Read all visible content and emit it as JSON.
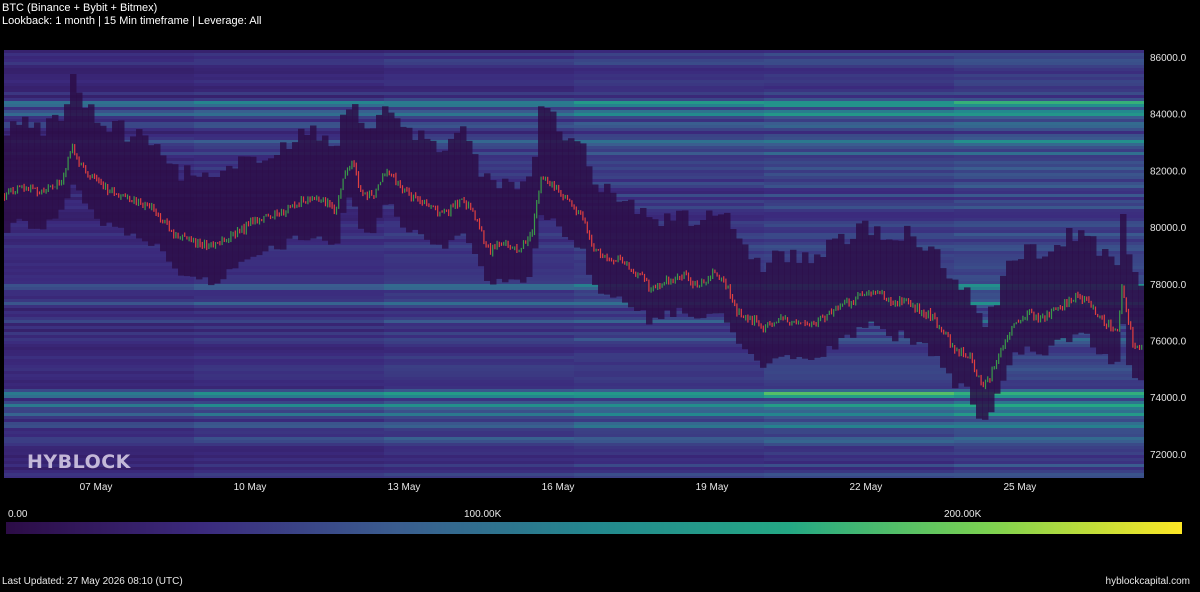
{
  "header": {
    "title": "BTC (Binance + Bybit + Bitmex)",
    "subtitle": "Lookback: 1 month | 15 Min timeframe | Leverage: All"
  },
  "watermark": "HYBLOCK",
  "footer": {
    "last_updated": "Last Updated: 27 May 2026 08:10 (UTC)",
    "site": "hyblockcapital.com"
  },
  "colors": {
    "background": "#000000",
    "colormap": [
      "#2c0c46",
      "#3b2a7d",
      "#3a5d8f",
      "#23888e",
      "#24a884",
      "#7ad151",
      "#fde725"
    ],
    "candle_up": "#3a9a4a",
    "candle_down": "#e04040"
  },
  "chart_data": {
    "type": "heatmap",
    "title": "BTC (Binance + Bybit + Bitmex)",
    "x_ticks": [
      "07 May",
      "10 May",
      "13 May",
      "16 May",
      "19 May",
      "22 May",
      "25 May"
    ],
    "x_range": [
      "05 May",
      "27 May 08:10"
    ],
    "y_ticks": [
      "72000.0",
      "74000.0",
      "76000.0",
      "78000.0",
      "80000.0",
      "82000.0",
      "84000.0",
      "86000.0"
    ],
    "ylim": [
      71000,
      86300
    ],
    "colorbar": {
      "labels": [
        "0.00",
        "100.00K",
        "200.00K"
      ],
      "ticks": [
        0,
        100000,
        200000
      ],
      "max": 245000
    },
    "liquidation_bands": [
      {
        "price": 84350,
        "intensity": 190000
      },
      {
        "price": 84000,
        "intensity": 160000
      },
      {
        "price": 83600,
        "intensity": 120000
      },
      {
        "price": 83000,
        "intensity": 140000
      },
      {
        "price": 82600,
        "intensity": 100000
      },
      {
        "price": 77900,
        "intensity": 150000
      },
      {
        "price": 77300,
        "intensity": 130000
      },
      {
        "price": 76700,
        "intensity": 110000
      },
      {
        "price": 76000,
        "intensity": 100000
      },
      {
        "price": 74100,
        "intensity": 210000
      },
      {
        "price": 73700,
        "intensity": 170000
      },
      {
        "price": 73400,
        "intensity": 150000
      },
      {
        "price": 73000,
        "intensity": 140000
      },
      {
        "price": 72500,
        "intensity": 120000
      }
    ],
    "price_series": {
      "name": "BTC",
      "points": [
        [
          "05 May 00:00",
          80900
        ],
        [
          "05 May 12:00",
          81400
        ],
        [
          "06 May 00:00",
          81200
        ],
        [
          "06 May 08:00",
          81700
        ],
        [
          "06 May 13:00",
          82800
        ],
        [
          "06 May 20:00",
          81800
        ],
        [
          "07 May 06:00",
          81300
        ],
        [
          "07 May 16:00",
          81000
        ],
        [
          "08 May 02:00",
          80700
        ],
        [
          "08 May 12:00",
          79800
        ],
        [
          "08 May 22:00",
          79500
        ],
        [
          "09 May 08:00",
          79300
        ],
        [
          "09 May 18:00",
          79800
        ],
        [
          "10 May 04:00",
          80300
        ],
        [
          "10 May 14:00",
          80500
        ],
        [
          "11 May 00:00",
          80900
        ],
        [
          "11 May 10:00",
          81000
        ],
        [
          "11 May 16:00",
          80600
        ],
        [
          "11 May 20:00",
          81900
        ],
        [
          "12 May 00:00",
          82400
        ],
        [
          "12 May 04:00",
          81100
        ],
        [
          "12 May 10:00",
          81200
        ],
        [
          "12 May 16:00",
          82100
        ],
        [
          "12 May 22:00",
          81400
        ],
        [
          "13 May 08:00",
          80900
        ],
        [
          "13 May 18:00",
          80400
        ],
        [
          "14 May 04:00",
          81000
        ],
        [
          "14 May 10:00",
          80200
        ],
        [
          "14 May 16:00",
          79100
        ],
        [
          "14 May 22:00",
          79500
        ],
        [
          "15 May 06:00",
          79200
        ],
        [
          "15 May 12:00",
          79800
        ],
        [
          "15 May 16:00",
          81700
        ],
        [
          "15 May 22:00",
          81500
        ],
        [
          "16 May 04:00",
          80900
        ],
        [
          "16 May 12:00",
          80300
        ],
        [
          "16 May 16:00",
          79200
        ],
        [
          "16 May 22:00",
          78900
        ],
        [
          "17 May 06:00",
          78800
        ],
        [
          "17 May 14:00",
          78300
        ],
        [
          "17 May 20:00",
          77800
        ],
        [
          "18 May 02:00",
          78100
        ],
        [
          "18 May 10:00",
          78300
        ],
        [
          "18 May 18:00",
          77900
        ],
        [
          "19 May 00:00",
          78400
        ],
        [
          "19 May 06:00",
          78100
        ],
        [
          "19 May 12:00",
          77000
        ],
        [
          "19 May 18:00",
          76800
        ],
        [
          "20 May 00:00",
          76400
        ],
        [
          "20 May 08:00",
          76800
        ],
        [
          "20 May 16:00",
          76600
        ],
        [
          "21 May 00:00",
          76600
        ],
        [
          "21 May 06:00",
          76900
        ],
        [
          "21 May 12:00",
          77200
        ],
        [
          "21 May 18:00",
          77400
        ],
        [
          "22 May 00:00",
          77700
        ],
        [
          "22 May 06:00",
          77800
        ],
        [
          "22 May 12:00",
          77200
        ],
        [
          "22 May 18:00",
          77500
        ],
        [
          "23 May 00:00",
          77100
        ],
        [
          "23 May 06:00",
          76900
        ],
        [
          "23 May 12:00",
          76300
        ],
        [
          "23 May 18:00",
          75600
        ],
        [
          "24 May 00:00",
          75500
        ],
        [
          "24 May 06:00",
          74400
        ],
        [
          "24 May 10:00",
          74700
        ],
        [
          "24 May 16:00",
          75800
        ],
        [
          "24 May 22:00",
          76700
        ],
        [
          "25 May 04:00",
          76900
        ],
        [
          "25 May 10:00",
          76700
        ],
        [
          "25 May 16:00",
          77100
        ],
        [
          "25 May 22:00",
          77300
        ],
        [
          "26 May 04:00",
          77600
        ],
        [
          "26 May 10:00",
          77100
        ],
        [
          "26 May 16:00",
          76600
        ],
        [
          "26 May 22:00",
          76400
        ],
        [
          "27 May 00:00",
          78100
        ],
        [
          "27 May 02:00",
          76800
        ],
        [
          "27 May 05:00",
          75900
        ],
        [
          "27 May 08:00",
          75700
        ]
      ]
    }
  }
}
